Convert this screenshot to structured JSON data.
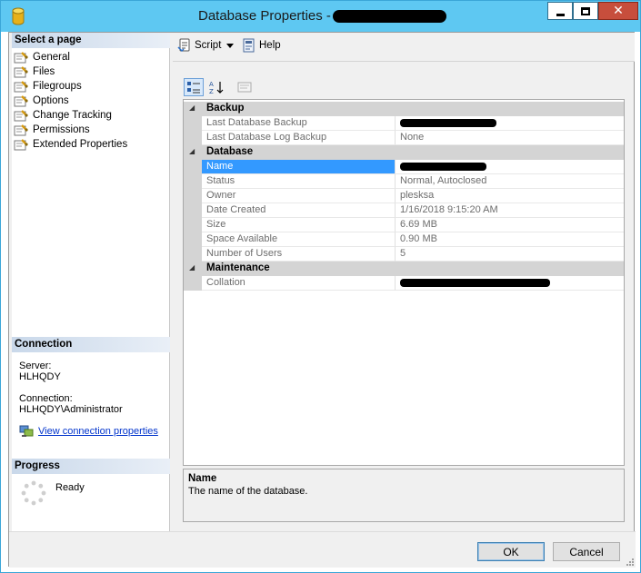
{
  "window": {
    "title": "Database Properties - ",
    "title_redacted": true
  },
  "left_pane": {
    "select_page_header": "Select a page",
    "pages": [
      "General",
      "Files",
      "Filegroups",
      "Options",
      "Change Tracking",
      "Permissions",
      "Extended Properties"
    ],
    "connection_header": "Connection",
    "server_label": "Server:",
    "server_value": "HLHQDY",
    "connection_label": "Connection:",
    "connection_value": "HLHQDY\\Administrator",
    "view_connection_link": "View connection properties",
    "progress_header": "Progress",
    "progress_status": "Ready"
  },
  "toolbar": {
    "script_label": "Script",
    "help_label": "Help"
  },
  "property_grid": {
    "categories": [
      {
        "name": "Backup",
        "properties": [
          {
            "name": "Last Database Backup",
            "value": "",
            "redacted": true
          },
          {
            "name": "Last Database Log Backup",
            "value": "None",
            "redacted": false
          }
        ]
      },
      {
        "name": "Database",
        "properties": [
          {
            "name": "Name",
            "value": "",
            "redacted": true,
            "selected": true
          },
          {
            "name": "Status",
            "value": "Normal, Autoclosed",
            "redacted": false
          },
          {
            "name": "Owner",
            "value": "plesksa",
            "redacted": false
          },
          {
            "name": "Date Created",
            "value": "1/16/2018 9:15:20 AM",
            "redacted": false
          },
          {
            "name": "Size",
            "value": "6.69 MB",
            "redacted": false
          },
          {
            "name": "Space Available",
            "value": "0.90 MB",
            "redacted": false
          },
          {
            "name": "Number of Users",
            "value": "5",
            "redacted": false
          }
        ]
      },
      {
        "name": "Maintenance",
        "properties": [
          {
            "name": "Collation",
            "value": "",
            "redacted": true
          }
        ]
      }
    ]
  },
  "description": {
    "title": "Name",
    "text": "The name of the database."
  },
  "buttons": {
    "ok": "OK",
    "cancel": "Cancel"
  },
  "colors": {
    "titlebar": "#5ec8f2",
    "selection": "#3399ff",
    "category_band": "#d4d4d4",
    "link": "#0033cc"
  }
}
